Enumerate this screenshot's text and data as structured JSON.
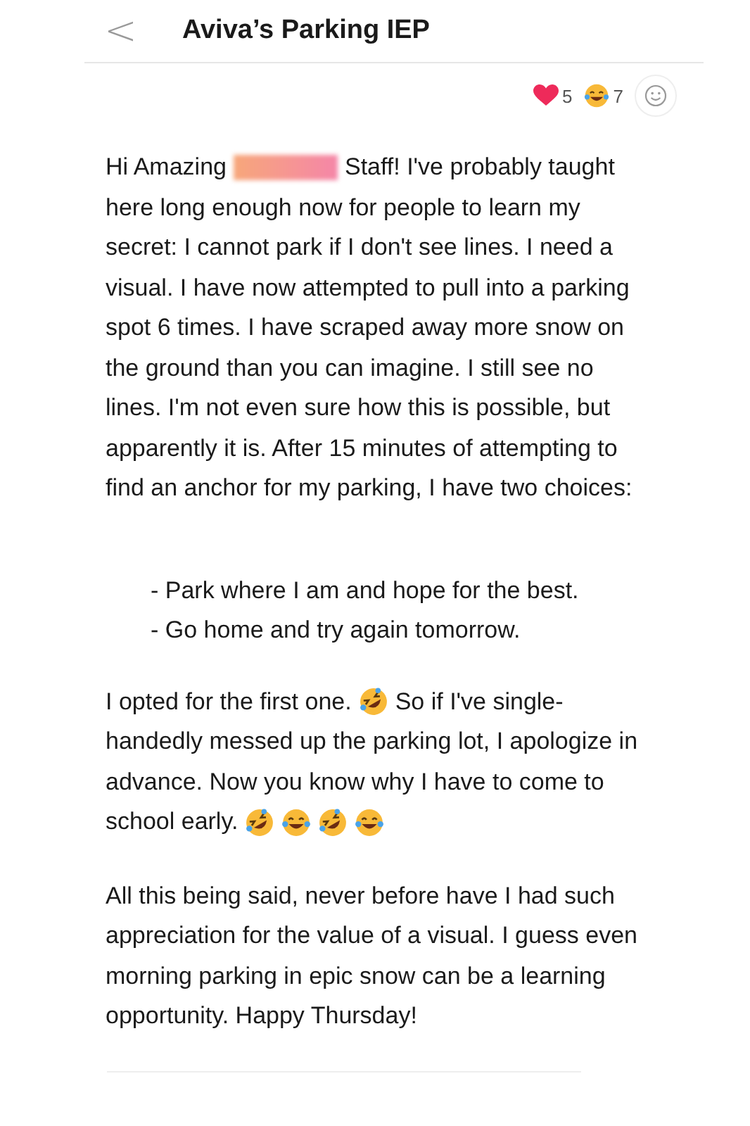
{
  "header": {
    "back": "<",
    "title": "Aviva’s Parking IEP"
  },
  "reactions": [
    {
      "kind": "heart",
      "count": "5"
    },
    {
      "kind": "joy",
      "count": "7"
    }
  ],
  "blocks": [
    {
      "kind": "text",
      "lines": [
        [
          {
            "kind": "text",
            "text": "Hi Amazing"
          },
          {
            "kind": "redaction"
          },
          {
            "kind": "text",
            "text": "Staff! I've probably taught"
          }
        ],
        [
          {
            "kind": "text",
            "text": "here long enough now for people to learn my"
          }
        ],
        [
          {
            "kind": "text",
            "text": "secret: I cannot park if I don't see lines. I need a"
          }
        ],
        [
          {
            "kind": "text",
            "text": "visual. I have now attempted to pull into a parking"
          }
        ],
        [
          {
            "kind": "text",
            "text": "spot 6 times. I have scraped away more snow on"
          }
        ],
        [
          {
            "kind": "text",
            "text": "the ground than you can imagine. I still see no"
          }
        ],
        [
          {
            "kind": "text",
            "text": "lines. I'm not even sure how this is possible, but"
          }
        ],
        [
          {
            "kind": "text",
            "text": "apparently it is. After 15 minutes of attempting to"
          }
        ],
        [
          {
            "kind": "text",
            "text": "find an anchor for my parking, I have two choices:"
          }
        ]
      ]
    },
    {
      "kind": "list",
      "items": [
        "- Park where I am and hope for the best.",
        "- Go home and try again tomorrow."
      ]
    },
    {
      "kind": "text",
      "lines": [
        [
          {
            "kind": "text",
            "text": "I opted for the first one."
          },
          {
            "kind": "rofl"
          },
          {
            "kind": "text",
            "text": "So if I've single-"
          }
        ],
        [
          {
            "kind": "text",
            "text": "handedly messed up the parking lot, I apologize in"
          }
        ],
        [
          {
            "kind": "text",
            "text": "advance. Now you know why I have to come to"
          }
        ],
        [
          {
            "kind": "text",
            "text": "school early."
          },
          {
            "kind": "rofl"
          },
          {
            "kind": "joy"
          },
          {
            "kind": "rofl"
          },
          {
            "kind": "joy"
          }
        ]
      ]
    },
    {
      "kind": "text",
      "lines": [
        [
          {
            "kind": "text",
            "text": "All this being said, never before have I had such"
          }
        ],
        [
          {
            "kind": "text",
            "text": "appreciation for the value of a visual. I guess even"
          }
        ],
        [
          {
            "kind": "text",
            "text": "morning parking in epic snow can be a learning"
          }
        ],
        [
          {
            "kind": "text",
            "text": "opportunity. Happy Thursday!"
          }
        ]
      ]
    }
  ]
}
